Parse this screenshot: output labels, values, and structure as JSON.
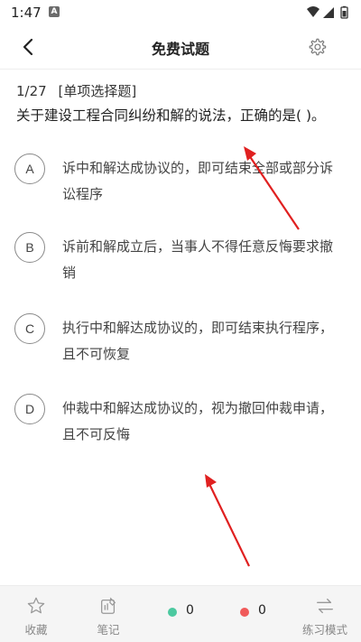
{
  "status_bar": {
    "time": "1:47",
    "notification_badge": "A",
    "icons": [
      "wifi-icon",
      "signal-icon",
      "battery-icon"
    ]
  },
  "nav": {
    "title": "免费试题",
    "back_icon": "chevron-left-icon",
    "settings_icon": "gear-icon"
  },
  "question": {
    "progress": "1/27",
    "type": "[单项选择题]",
    "text": "关于建设工程合同纠纷和解的说法，正确的是( )。",
    "options": [
      {
        "letter": "A",
        "text": "诉中和解达成协议的，即可结束全部或部分诉讼程序"
      },
      {
        "letter": "B",
        "text": "诉前和解成立后，当事人不得任意反悔要求撤销"
      },
      {
        "letter": "C",
        "text": "执行中和解达成协议的，即可结束执行程序，且不可恢复"
      },
      {
        "letter": "D",
        "text": "仲裁中和解达成协议的，视为撤回仲裁申请，且不可反悔"
      }
    ]
  },
  "bottom_bar": {
    "favorite_label": "收藏",
    "notes_label": "笔记",
    "correct_count": "0",
    "wrong_count": "0",
    "mode_label": "练习模式",
    "correct_color": "#4cc9a0",
    "wrong_color": "#f05a5a"
  },
  "colors": {
    "annotation_arrow": "#e02020"
  }
}
